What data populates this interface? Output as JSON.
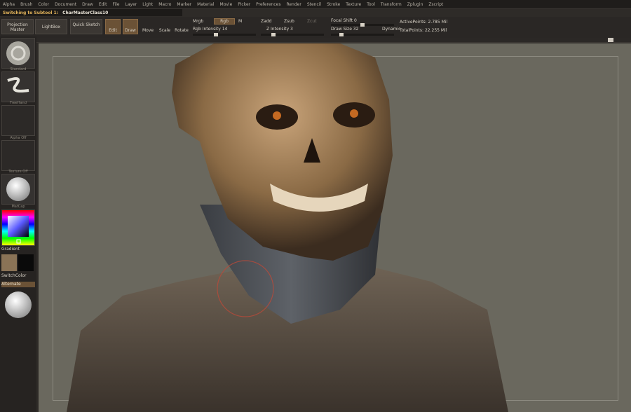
{
  "menu": [
    "Alpha",
    "Brush",
    "Color",
    "Document",
    "Draw",
    "Edit",
    "File",
    "Layer",
    "Light",
    "Macro",
    "Marker",
    "Material",
    "Movie",
    "Picker",
    "Preferences",
    "Render",
    "Stencil",
    "Stroke",
    "Texture",
    "Tool",
    "Transform",
    "Zplugin",
    "Zscript"
  ],
  "subtool": {
    "label": "Switching to Subtool 1:",
    "name": "CharMasterClass10"
  },
  "toolbar": {
    "projection_master": "Projection Master",
    "lightbox": "LightBox",
    "quick_sketch": "Quick Sketch",
    "edit": "Edit",
    "draw": "Draw",
    "move": "Move",
    "scale": "Scale",
    "rotate": "Rotate",
    "mrgb": "Mrgb",
    "rgb": "Rgb",
    "m": "M",
    "rgb_intensity": "Rgb  Intensity 14",
    "zadd": "Zadd",
    "zsub": "Zsub",
    "zcut": "Zcut",
    "z_intensity": "Z Intensity 3",
    "focal_shift": "Focal Shift 0",
    "draw_size": "Draw Size 32",
    "dynamic": "Dynamic",
    "active_points": "ActivePoints: 2.785 Mil",
    "total_points": "TotalPoints: 22.255 Mil"
  },
  "left": {
    "standard": "Standard",
    "freehand": "FreeHand",
    "alpha_off": "Alpha Off",
    "texture_off": "Texture Off",
    "matcap": "MatCap",
    "gradient": "Gradient",
    "switch_color": "SwitchColor",
    "alternate": "Alternate"
  },
  "colors": {
    "primary": "#8a7356",
    "secondary": "#0a0a0a",
    "accent": "#e0b25a"
  }
}
